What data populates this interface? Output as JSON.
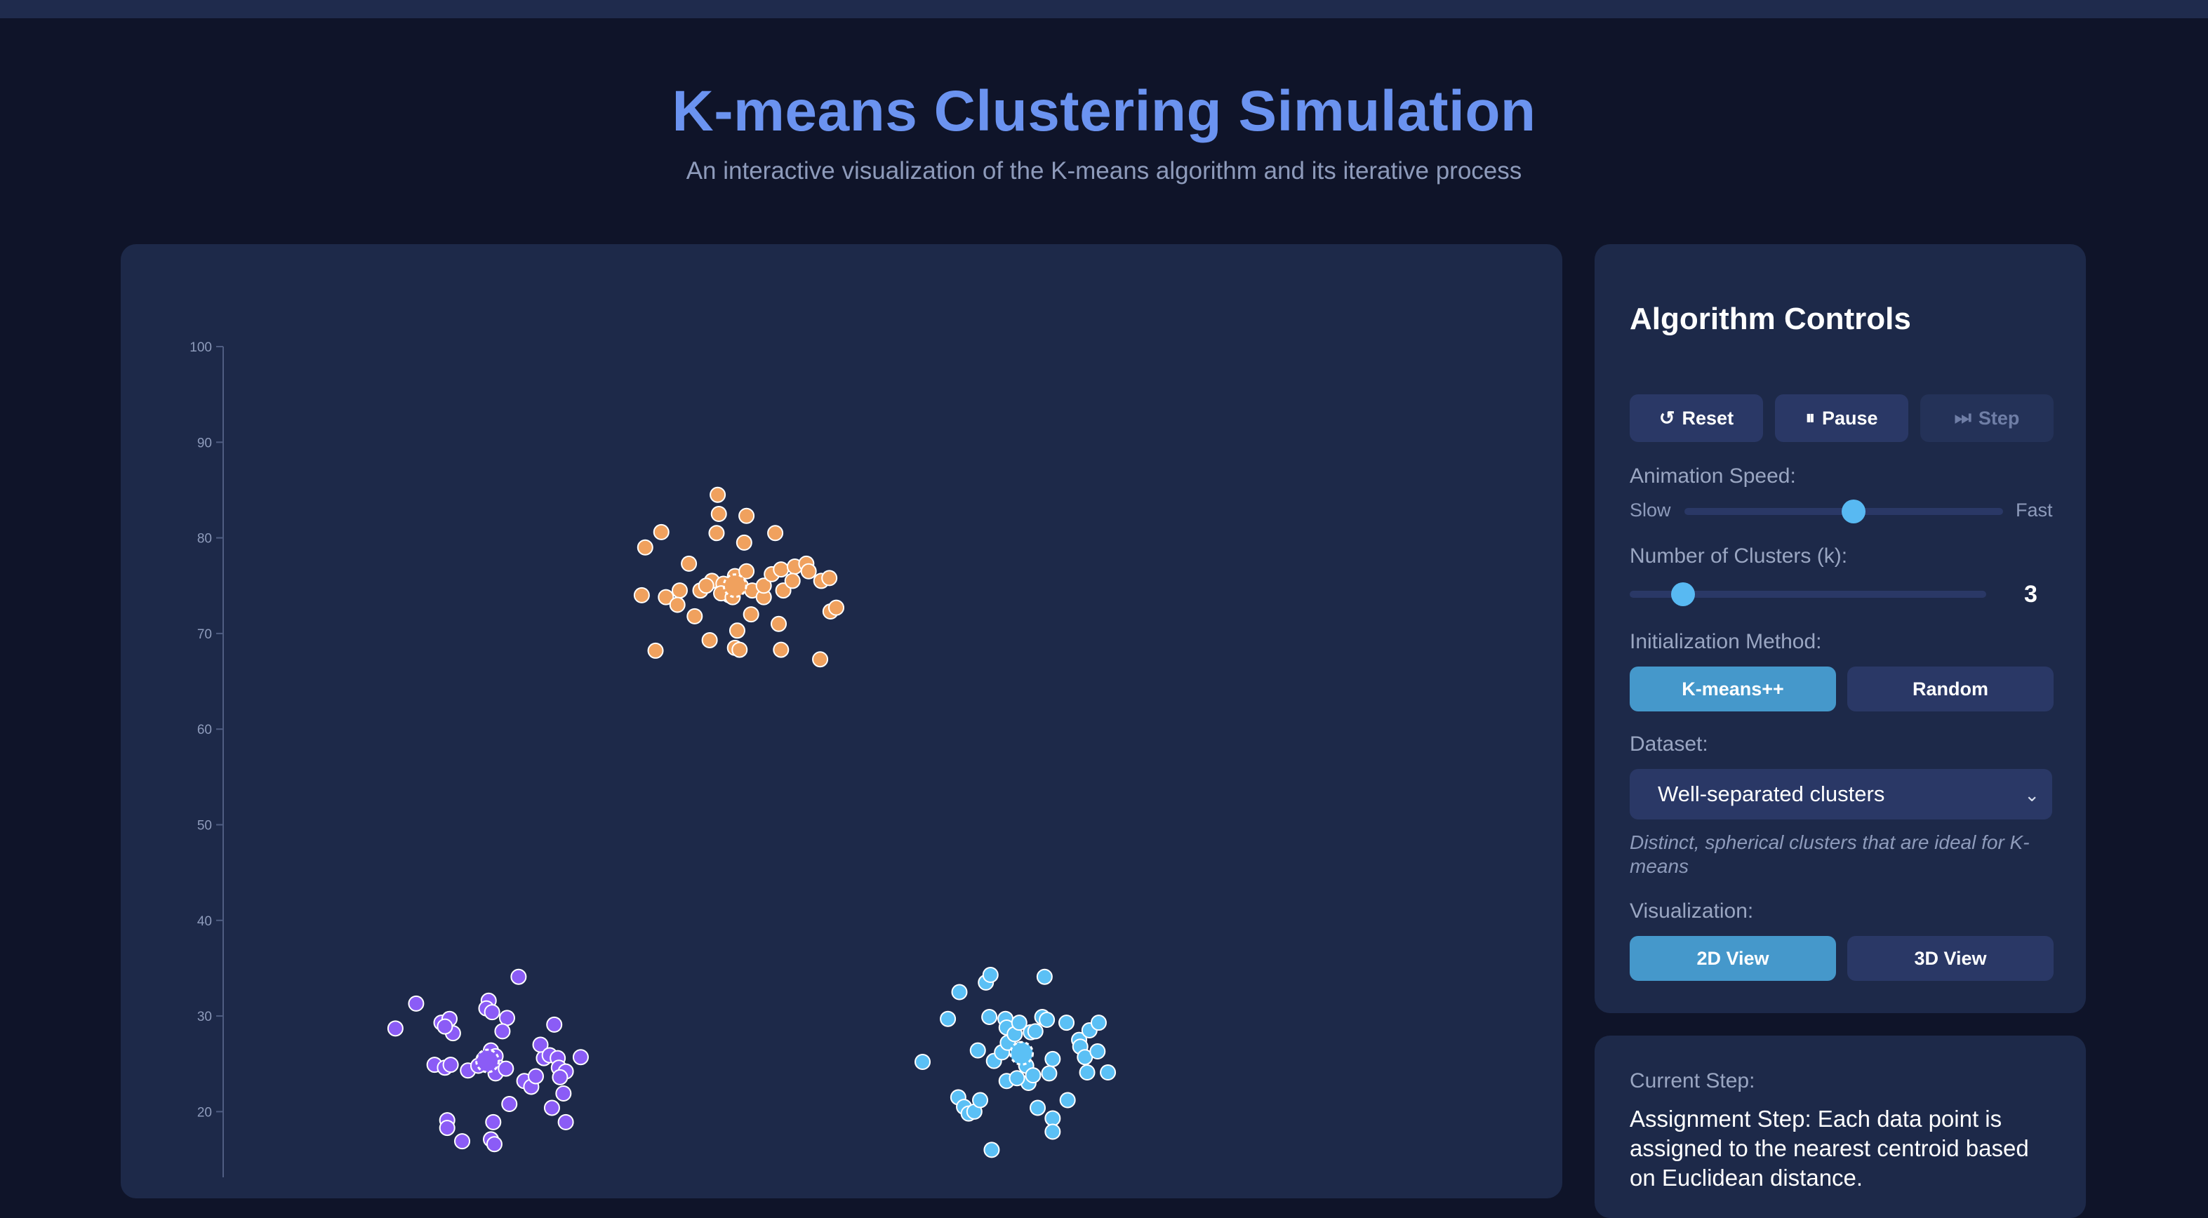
{
  "header": {
    "title": "K-means Clustering Simulation",
    "subtitle": "An interactive visualization of the K-means algorithm and its iterative process"
  },
  "controls": {
    "title": "Algorithm Controls",
    "reset_label": "Reset",
    "pause_label": "Pause",
    "step_label": "Step",
    "speed_label": "Animation Speed:",
    "speed_slow": "Slow",
    "speed_fast": "Fast",
    "speed_value": 0.53,
    "clusters_label": "Number of Clusters (k):",
    "clusters_value": "3",
    "clusters_fraction": 0.15,
    "init_label": "Initialization Method:",
    "init_options": [
      "K-means++",
      "Random"
    ],
    "init_selected": "K-means++",
    "dataset_label": "Dataset:",
    "dataset_value": "Well-separated clusters",
    "dataset_description": "Distinct, spherical clusters that are ideal for K-means",
    "viz_label": "Visualization:",
    "viz_options": [
      "2D View",
      "3D View"
    ],
    "viz_selected": "2D View"
  },
  "current_step": {
    "label": "Current Step:",
    "text": "Assignment Step: Each data point is assigned to the nearest centroid based on Euclidean distance."
  },
  "colors": {
    "cluster_orange": "#f0a15e",
    "cluster_purple": "#8b5cf6",
    "cluster_blue": "#5bc0f5",
    "accent": "#4598cb"
  },
  "chart_data": {
    "type": "scatter",
    "yticks": [
      20,
      30,
      40,
      50,
      60,
      70,
      80,
      90,
      100
    ],
    "ylim": [
      15,
      100
    ],
    "xlim": [
      0,
      100
    ],
    "series": [
      {
        "color": "#f0a15e",
        "centroid": [
          43,
          75
        ],
        "points": [
          [
            41.5,
            84.5
          ],
          [
            41.6,
            82.5
          ],
          [
            44.0,
            82.3
          ],
          [
            41.4,
            80.5
          ],
          [
            43.8,
            79.5
          ],
          [
            46.5,
            80.5
          ],
          [
            35.2,
            79
          ],
          [
            36.6,
            80.6
          ],
          [
            39,
            77.3
          ],
          [
            37,
            73.8
          ],
          [
            38.2,
            74.5
          ],
          [
            38,
            73
          ],
          [
            39.5,
            71.8
          ],
          [
            40,
            74.5
          ],
          [
            41,
            75.5
          ],
          [
            42,
            75.2
          ],
          [
            42.5,
            74
          ],
          [
            43,
            76
          ],
          [
            43.5,
            75
          ],
          [
            44,
            76.5
          ],
          [
            44.5,
            74.5
          ],
          [
            45.5,
            73.8
          ],
          [
            45.5,
            75
          ],
          [
            46.2,
            76.2
          ],
          [
            47,
            76.7
          ],
          [
            47.2,
            74.5
          ],
          [
            48.2,
            77
          ],
          [
            48,
            75.5
          ],
          [
            49.2,
            77.3
          ],
          [
            49.4,
            76.5
          ],
          [
            50.5,
            75.5
          ],
          [
            51.2,
            75.8
          ],
          [
            51.3,
            72.3
          ],
          [
            51.8,
            72.7
          ],
          [
            34.9,
            74
          ],
          [
            36.1,
            68.2
          ],
          [
            40.8,
            69.3
          ],
          [
            43,
            68.5
          ],
          [
            43.4,
            68.3
          ],
          [
            43.2,
            70.3
          ],
          [
            44.4,
            72
          ],
          [
            46.8,
            71
          ],
          [
            47,
            68.3
          ],
          [
            50.4,
            67.3
          ],
          [
            40.5,
            75
          ],
          [
            41.8,
            74.2
          ],
          [
            42.8,
            73.8
          ]
        ]
      },
      {
        "color": "#8b5cf6",
        "centroid": [
          21.5,
          25.3
        ],
        "points": [
          [
            13.5,
            28.7
          ],
          [
            15.3,
            31.3
          ],
          [
            17.5,
            29.3
          ],
          [
            18.2,
            29.7
          ],
          [
            18.5,
            28.2
          ],
          [
            17.8,
            28.9
          ],
          [
            21.6,
            31.6
          ],
          [
            21.4,
            30.8
          ],
          [
            21.9,
            30.4
          ],
          [
            23.2,
            29.8
          ],
          [
            22.8,
            28.4
          ],
          [
            24.2,
            34.1
          ],
          [
            16.9,
            24.9
          ],
          [
            17.8,
            24.6
          ],
          [
            18.3,
            24.9
          ],
          [
            19.8,
            24.3
          ],
          [
            20.7,
            24.8
          ],
          [
            21.2,
            25.5
          ],
          [
            21.8,
            26.4
          ],
          [
            22.2,
            25.8
          ],
          [
            22.5,
            24.6
          ],
          [
            22.2,
            24
          ],
          [
            23.1,
            24.5
          ],
          [
            24.7,
            23.2
          ],
          [
            25.3,
            22.6
          ],
          [
            25.7,
            23.7
          ],
          [
            26.4,
            25.6
          ],
          [
            26.1,
            27
          ],
          [
            26.9,
            25.9
          ],
          [
            27.3,
            29.1
          ],
          [
            27.6,
            25.6
          ],
          [
            27.7,
            24.6
          ],
          [
            28.3,
            24.2
          ],
          [
            27.8,
            23.6
          ],
          [
            28.1,
            21.9
          ],
          [
            29.6,
            25.7
          ],
          [
            18,
            19.1
          ],
          [
            18,
            18.3
          ],
          [
            19.3,
            16.9
          ],
          [
            22,
            18.9
          ],
          [
            21.8,
            17.1
          ],
          [
            22.1,
            16.6
          ],
          [
            23.4,
            20.8
          ],
          [
            27.1,
            20.4
          ],
          [
            28.3,
            18.9
          ]
        ]
      },
      {
        "color": "#5bc0f5",
        "centroid": [
          67.9,
          26.1
        ],
        "points": [
          [
            59.3,
            25.2
          ],
          [
            61.5,
            29.7
          ],
          [
            62.5,
            32.5
          ],
          [
            64.8,
            33.5
          ],
          [
            65.2,
            34.3
          ],
          [
            69.9,
            34.1
          ],
          [
            64.1,
            26.4
          ],
          [
            65.1,
            29.9
          ],
          [
            65.5,
            25.3
          ],
          [
            66.2,
            26.2
          ],
          [
            66.7,
            27.2
          ],
          [
            66.5,
            29.7
          ],
          [
            66.6,
            28.8
          ],
          [
            67.3,
            28.1
          ],
          [
            67.7,
            29.3
          ],
          [
            67.8,
            26.5
          ],
          [
            68,
            25.7
          ],
          [
            68.3,
            24.8
          ],
          [
            68.5,
            23
          ],
          [
            68.7,
            28.3
          ],
          [
            69.1,
            28.4
          ],
          [
            69.7,
            29.9
          ],
          [
            70.1,
            29.6
          ],
          [
            70.6,
            25.5
          ],
          [
            70.3,
            24
          ],
          [
            71.8,
            29.3
          ],
          [
            72.9,
            27.5
          ],
          [
            73,
            26.8
          ],
          [
            73.4,
            25.7
          ],
          [
            73.8,
            28.5
          ],
          [
            74.5,
            26.3
          ],
          [
            74.6,
            29.3
          ],
          [
            75.4,
            24.1
          ],
          [
            73.6,
            24.1
          ],
          [
            62.4,
            21.5
          ],
          [
            62.9,
            20.5
          ],
          [
            63.3,
            19.8
          ],
          [
            63.8,
            20
          ],
          [
            64.3,
            21.2
          ],
          [
            66.6,
            23.2
          ],
          [
            69.3,
            20.4
          ],
          [
            70.6,
            19.3
          ],
          [
            70.6,
            17.9
          ],
          [
            71.9,
            21.2
          ],
          [
            65.3,
            16
          ],
          [
            67.5,
            23.5
          ],
          [
            68.9,
            23.8
          ]
        ]
      }
    ]
  }
}
